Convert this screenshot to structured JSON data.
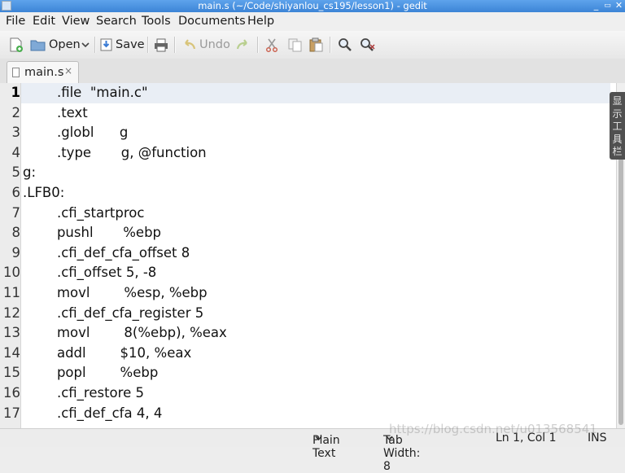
{
  "window": {
    "title": "main.s (~/Code/shiyanlou_cs195/lesson1) - gedit",
    "minimize_glyph": "_",
    "restore_glyph": "▭",
    "close_glyph": "✕"
  },
  "menu": [
    "File",
    "Edit",
    "View",
    "Search",
    "Tools",
    "Documents",
    "Help"
  ],
  "toolbar": {
    "open_label": "Open",
    "save_label": "Save",
    "undo_label": "Undo"
  },
  "tab": {
    "label": "main.s",
    "close_glyph": "×"
  },
  "editor": {
    "lines": [
      {
        "num": "1",
        "text": "        .file  \"main.c\""
      },
      {
        "num": "2",
        "text": "        .text"
      },
      {
        "num": "3",
        "text": "        .globl      g"
      },
      {
        "num": "4",
        "text": "        .type       g, @function"
      },
      {
        "num": "5",
        "text": "g:"
      },
      {
        "num": "6",
        "text": ".LFB0:"
      },
      {
        "num": "7",
        "text": "        .cfi_startproc"
      },
      {
        "num": "8",
        "text": "        pushl       %ebp"
      },
      {
        "num": "9",
        "text": "        .cfi_def_cfa_offset 8"
      },
      {
        "num": "10",
        "text": "        .cfi_offset 5, -8"
      },
      {
        "num": "11",
        "text": "        movl        %esp, %ebp"
      },
      {
        "num": "12",
        "text": "        .cfi_def_cfa_register 5"
      },
      {
        "num": "13",
        "text": "        movl        8(%ebp), %eax"
      },
      {
        "num": "14",
        "text": "        addl        $10, %eax"
      },
      {
        "num": "15",
        "text": "        popl        %ebp"
      },
      {
        "num": "16",
        "text": "        .cfi_restore 5"
      },
      {
        "num": "17",
        "text": "        .cfi_def_cfa 4, 4"
      }
    ]
  },
  "side_panel": {
    "chars": [
      "显",
      "示",
      "工",
      "具",
      "栏"
    ]
  },
  "statusbar": {
    "language": "Plain Text",
    "tab_width": "Tab Width: 8",
    "position": "Ln 1, Col 1",
    "mode": "INS"
  },
  "watermark": "https://blog.csdn.net/u013568541"
}
